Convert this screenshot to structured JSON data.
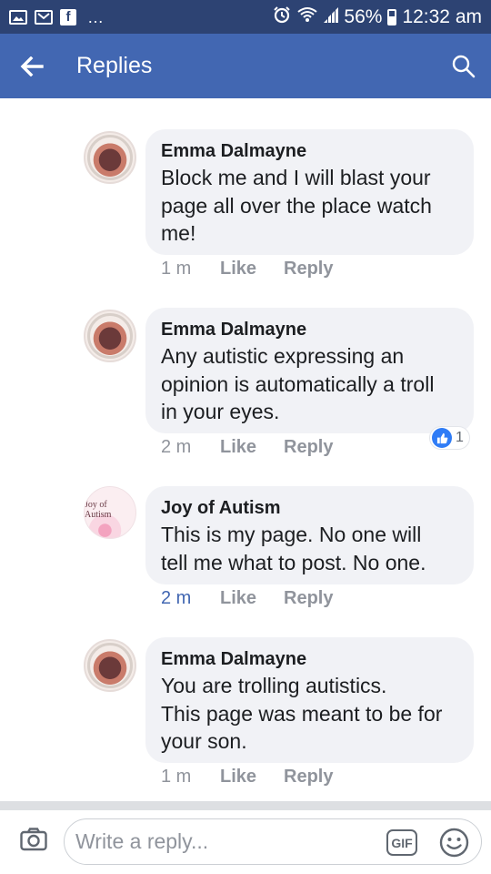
{
  "status_bar": {
    "battery": "56%",
    "time": "12:32 am",
    "dots": "…"
  },
  "app_bar": {
    "title": "Replies"
  },
  "comments": [
    {
      "author": "Emma Dalmayne",
      "lines": [
        "Block me and I will blast your",
        "page all over the place watch",
        "me!"
      ],
      "time": "1 m",
      "like_label": "Like",
      "reply_label": "Reply"
    },
    {
      "author": "Emma Dalmayne",
      "lines": [
        "Any autistic expressing an",
        "opinion is automatically a troll",
        "in your eyes."
      ],
      "time": "2 m",
      "like_label": "Like",
      "reply_label": "Reply",
      "reaction_count": "1"
    },
    {
      "author": "Joy of Autism",
      "avatar_text": "Joy of Autism",
      "lines": [
        "This is my page. No one will",
        "tell me what to post. No one."
      ],
      "time": "2 m",
      "like_label": "Like",
      "reply_label": "Reply"
    },
    {
      "author": "Emma Dalmayne",
      "lines": [
        "You are trolling autistics.",
        "This page was meant to be for",
        "your son."
      ],
      "time": "1 m",
      "like_label": "Like",
      "reply_label": "Reply"
    }
  ],
  "composer": {
    "placeholder": "Write a reply...",
    "gif_label": "GIF"
  },
  "colors": {
    "status_bar": "#2d4373",
    "app_bar": "#4267b2",
    "bubble": "#f1f2f6",
    "meta_text": "#90949c",
    "link_blue": "#4267b2"
  },
  "icons": [
    "image-icon",
    "gmail-icon",
    "facebook-icon",
    "alarm-icon",
    "wifi-icon",
    "signal-icon",
    "battery-icon",
    "back-arrow-icon",
    "search-icon",
    "like-reaction-icon",
    "camera-icon",
    "gif-icon",
    "emoji-icon"
  ]
}
